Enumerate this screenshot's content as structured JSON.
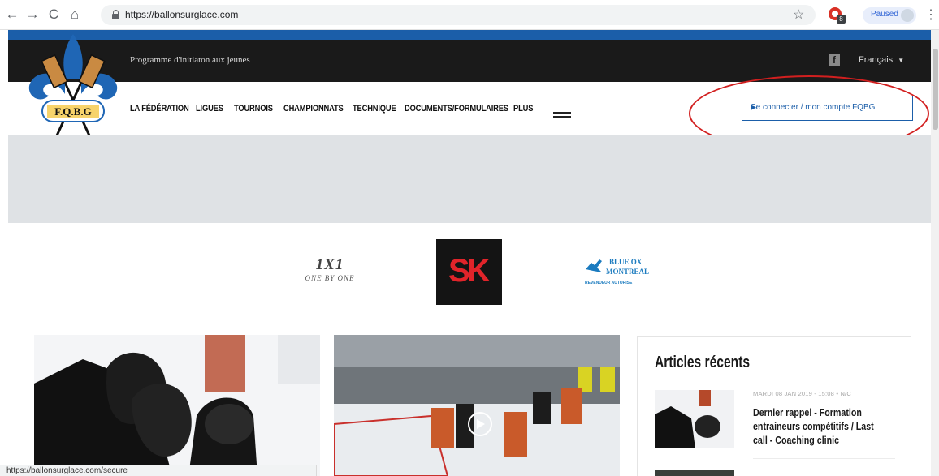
{
  "browser": {
    "url": "https://ballonsurglace.com",
    "profile_status": "Paused",
    "status_url": "https://ballonsurglace.com/secure"
  },
  "site": {
    "logo_text": "F.Q.B.G",
    "tagline": "Programme d'initiaton aux jeunes",
    "language": "Français",
    "nav": [
      "LA FÉDÉRATION",
      "LIGUES",
      "TOURNOIS",
      "CHAMPIONNATS",
      "TECHNIQUE",
      "DOCUMENTS/FORMULAIRES",
      "PLUS"
    ],
    "login_button": "Se connecter / mon compte FQBG",
    "sponsors": {
      "one_by_one_logo": "1X1",
      "one_by_one_text": "ONE BY ONE",
      "sk_text": "SK",
      "blue_ox_line1": "BLUE OX",
      "blue_ox_line2": "MONTREAL",
      "blue_ox_line3": "REVENDEUR AUTORISE"
    },
    "sidebar": {
      "title": "Articles récents",
      "article_meta": "MARDI 08 JAN 2019 - 15:08 • N/C",
      "article_title": "Dernier rappel - Formation entraineurs compétitifs / Last call - Coaching clinic"
    }
  },
  "colors": {
    "brand_blue": "#1b5ea9",
    "annotation_red": "#d21f1f",
    "dark_bar": "#1a1a1a"
  }
}
